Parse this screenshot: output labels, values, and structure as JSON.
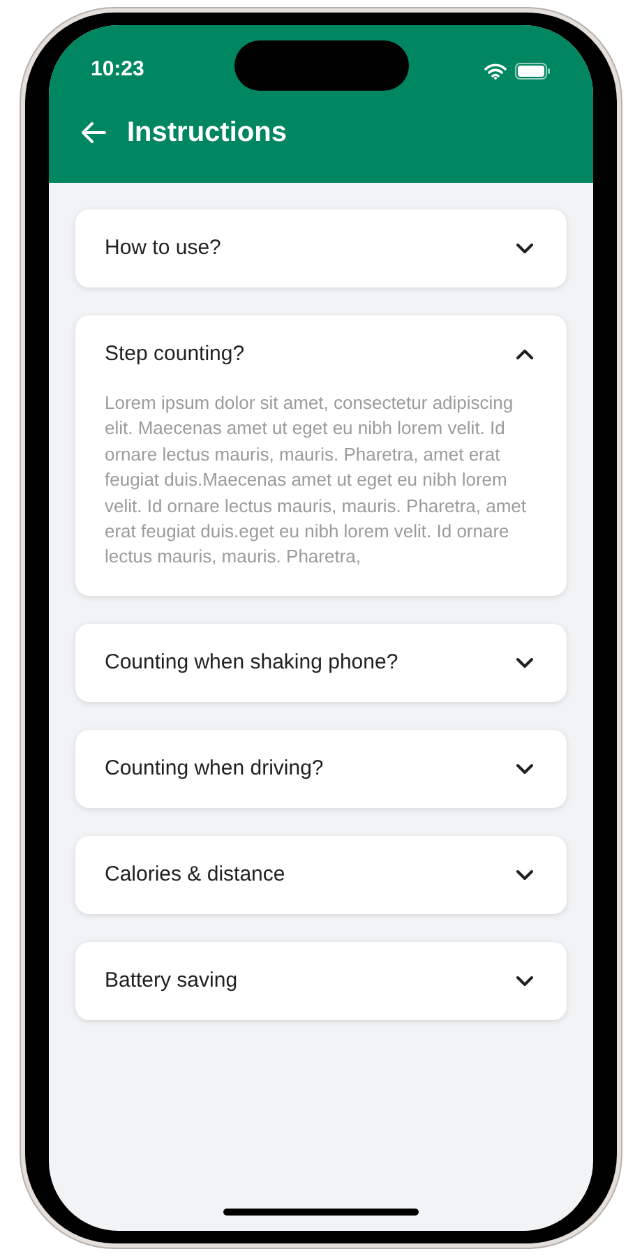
{
  "status_bar": {
    "time": "10:23"
  },
  "app_bar": {
    "title": "Instructions"
  },
  "sections": [
    {
      "title": "How to use?",
      "expanded": false
    },
    {
      "title": "Step counting?",
      "expanded": true,
      "body": "Lorem ipsum dolor sit amet, consectetur adipiscing elit. Maecenas amet ut eget eu nibh lorem velit. Id ornare lectus mauris, mauris. Pharetra, amet erat feugiat duis.Maecenas amet ut eget eu nibh lorem velit. Id ornare lectus mauris, mauris. Pharetra, amet erat feugiat duis.eget eu nibh lorem velit. Id ornare lectus mauris, mauris. Pharetra,"
    },
    {
      "title": "Counting when shaking phone?",
      "expanded": false
    },
    {
      "title": "Counting when driving?",
      "expanded": false
    },
    {
      "title": "Calories & distance",
      "expanded": false
    },
    {
      "title": "Battery saving",
      "expanded": false
    }
  ]
}
